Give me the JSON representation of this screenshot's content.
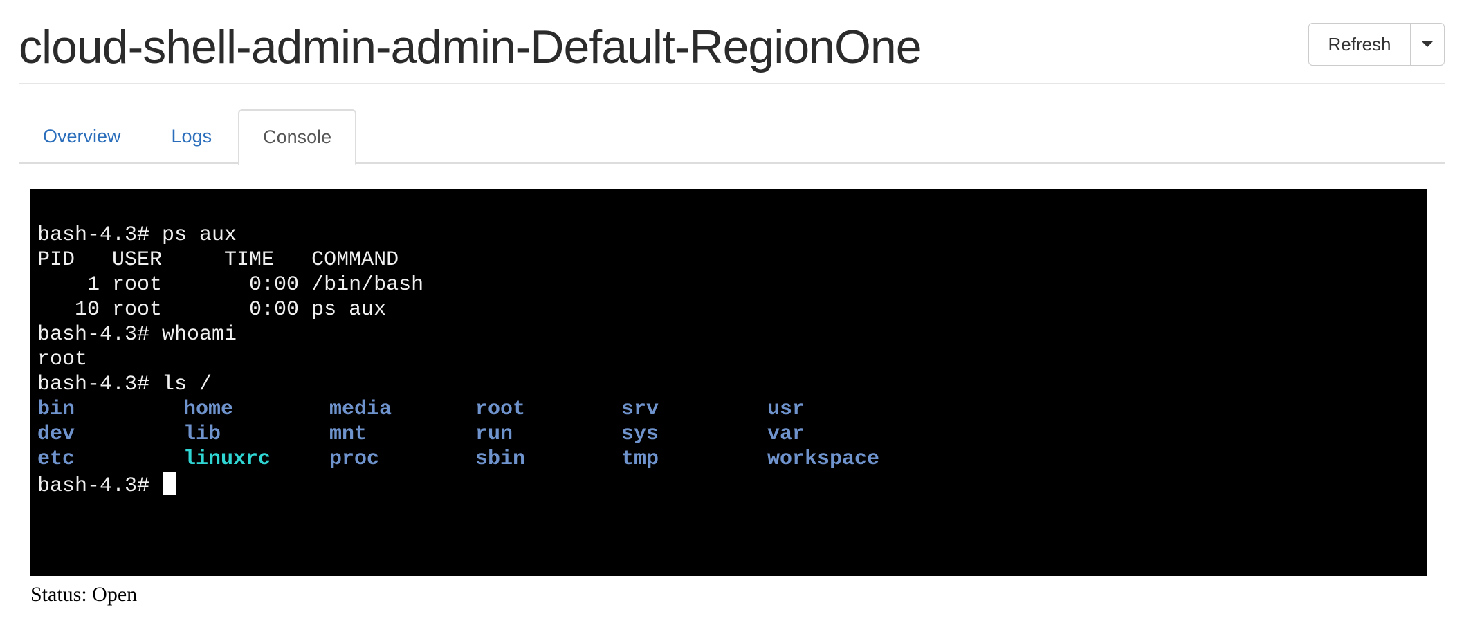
{
  "header": {
    "title": "cloud-shell-admin-admin-Default-RegionOne",
    "refresh_label": "Refresh"
  },
  "tabs": [
    {
      "label": "Overview",
      "active": false
    },
    {
      "label": "Logs",
      "active": false
    },
    {
      "label": "Console",
      "active": true
    }
  ],
  "terminal": {
    "lines": [
      "bash-4.3# ps aux",
      "PID   USER     TIME   COMMAND",
      "    1 root       0:00 /bin/bash",
      "   10 root       0:00 ps aux",
      "bash-4.3# whoami",
      "root",
      "bash-4.3# ls /"
    ],
    "ls_rows": [
      [
        {
          "name": "bin",
          "kind": "dir"
        },
        {
          "name": "home",
          "kind": "dir"
        },
        {
          "name": "media",
          "kind": "dir"
        },
        {
          "name": "root",
          "kind": "dir"
        },
        {
          "name": "srv",
          "kind": "dir"
        },
        {
          "name": "usr",
          "kind": "dir"
        }
      ],
      [
        {
          "name": "dev",
          "kind": "dir"
        },
        {
          "name": "lib",
          "kind": "dir"
        },
        {
          "name": "mnt",
          "kind": "dir"
        },
        {
          "name": "run",
          "kind": "dir"
        },
        {
          "name": "sys",
          "kind": "dir"
        },
        {
          "name": "var",
          "kind": "dir"
        }
      ],
      [
        {
          "name": "etc",
          "kind": "dir"
        },
        {
          "name": "linuxrc",
          "kind": "file"
        },
        {
          "name": "proc",
          "kind": "dir"
        },
        {
          "name": "sbin",
          "kind": "dir"
        },
        {
          "name": "tmp",
          "kind": "dir"
        },
        {
          "name": "workspace",
          "kind": "dir"
        }
      ]
    ],
    "prompt": "bash-4.3# ",
    "colors": {
      "background": "#000000",
      "text": "#f0f0f0",
      "dir": "#6f93cd",
      "file": "#2fd6d4"
    }
  },
  "status": {
    "text": "Status: Open"
  },
  "colors": {
    "link": "#2a6ebb",
    "title": "#2b2b2b"
  },
  "icons": {
    "dropdown": "caret-down-icon"
  }
}
